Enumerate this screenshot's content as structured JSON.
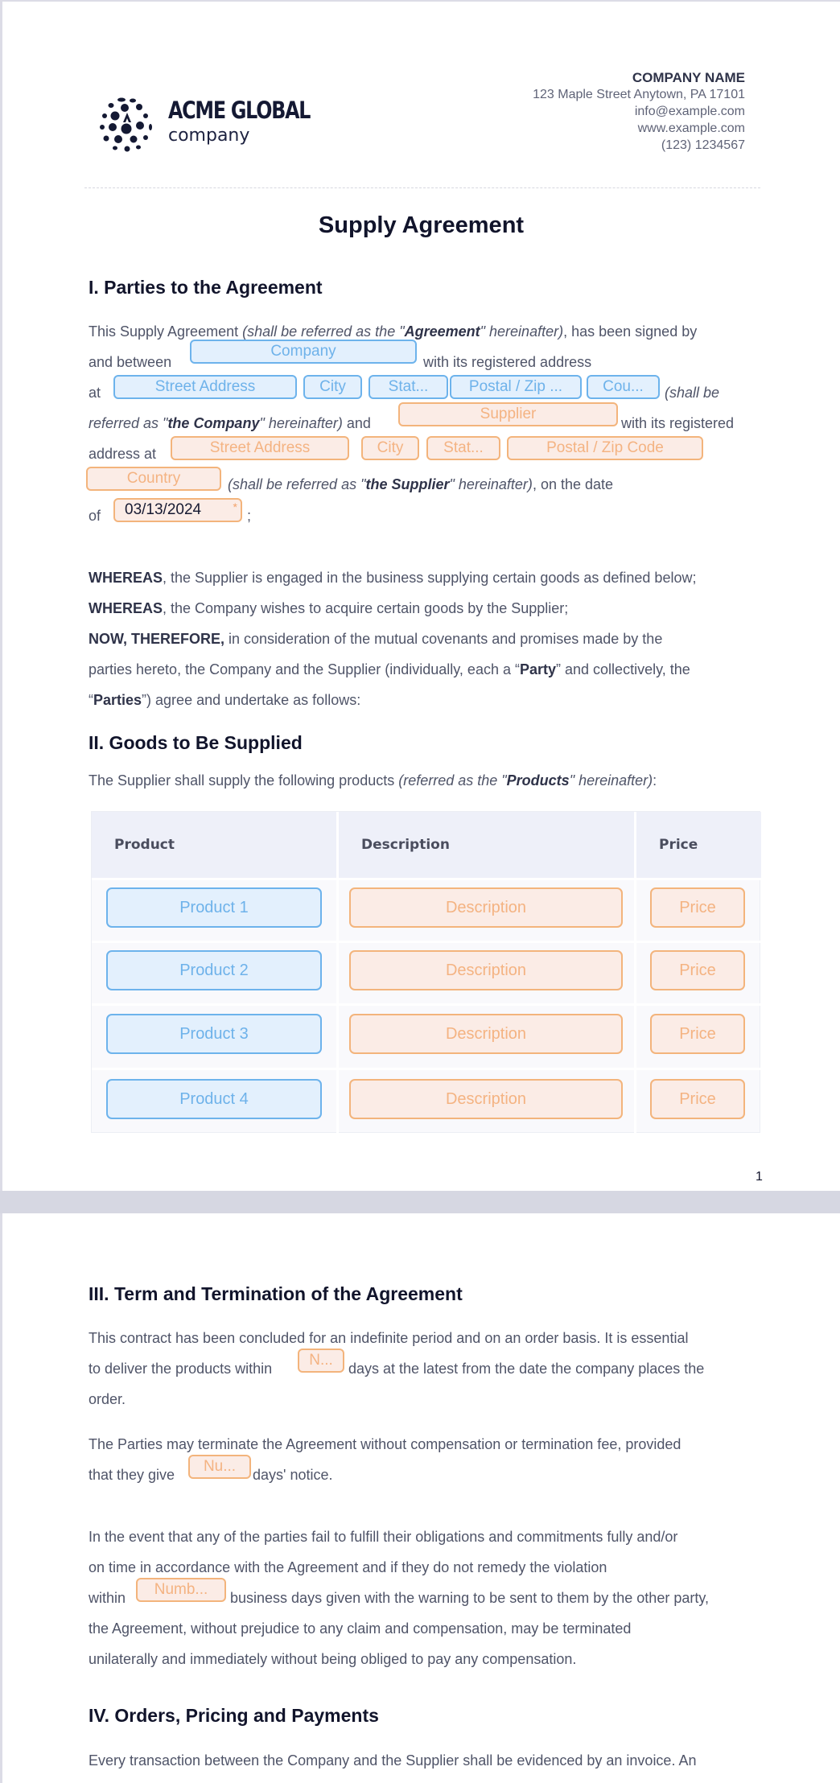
{
  "header": {
    "logo": {
      "title": "ACME GLOBAL",
      "subtitle": "company",
      "icon": "globe-dots-icon"
    },
    "company_block": {
      "name": "COMPANY NAME",
      "address": "123 Maple Street Anytown, PA 17101",
      "email": "info@example.com",
      "website": "www.example.com",
      "phone": "(123) 1234567"
    }
  },
  "document": {
    "title": "Supply Agreement",
    "colors": {
      "company_field": "#6db3ec",
      "supplier_field": "#f3b47c",
      "heading": "#11142b",
      "body_text": "#4f5468"
    }
  },
  "section1": {
    "heading": "I. Parties to the Agreement",
    "line1": {
      "a": "This Supply Agreement ",
      "b": "(shall be referred as the \"",
      "c": "Agreement",
      "d": "\" hereinafter)",
      "e": ", has been signed by"
    },
    "line2": {
      "a": "and between",
      "b": "with its registered address"
    },
    "line3": {
      "a": "at",
      "b": "(shall be"
    },
    "line4": {
      "a": "referred as \"",
      "b": "the Company",
      "c": "\" hereinafter)",
      "d": " and",
      "e": "with its registered"
    },
    "line5": {
      "a": "address at"
    },
    "line6": {
      "a": "(shall be referred as \"",
      "b": "the Supplier",
      "c": "\" hereinafter)",
      "d": ", on the date"
    },
    "line7": {
      "a": "of",
      "b": ";"
    },
    "company_fields": {
      "name": "Company",
      "street": "Street Address",
      "city": "City",
      "state": "Stat...",
      "postal": "Postal / Zip ...",
      "country": "Cou..."
    },
    "supplier_fields": {
      "name": "Supplier",
      "street": "Street Address",
      "city": "City",
      "state": "Stat...",
      "postal": "Postal / Zip Code",
      "country": "Country"
    },
    "date_field": {
      "value": "03/13/2024",
      "required_mark": "*"
    }
  },
  "recitals": {
    "r1": {
      "bold": "WHEREAS",
      "text": ", the Supplier is engaged in the business supplying certain goods as defined below;"
    },
    "r2": {
      "bold": "WHEREAS",
      "text": ", the Company wishes to acquire certain goods by the Supplier;"
    },
    "r3": {
      "bold": "NOW, THEREFORE,",
      "text": " in consideration of the mutual covenants and promises made by the"
    },
    "r4": {
      "a": "parties hereto, the Company and the Supplier (individually, each a “",
      "b": "Party",
      "c": "” and collectively, the"
    },
    "r5": {
      "a": "“",
      "b": "Parties",
      "c": "”) agree and undertake as follows:"
    }
  },
  "section2": {
    "heading": "II. Goods to Be Supplied",
    "intro": {
      "a": "The Supplier shall supply the following products ",
      "b": "(referred as the \"",
      "c": "Products",
      "d": "\" hereinafter)",
      "e": ":"
    },
    "table": {
      "headers": [
        "Product",
        "Description",
        "Price"
      ],
      "rows": [
        {
          "product": "Product 1",
          "description": "Description",
          "price": "Price"
        },
        {
          "product": "Product 2",
          "description": "Description",
          "price": "Price"
        },
        {
          "product": "Product 3",
          "description": "Description",
          "price": "Price"
        },
        {
          "product": "Product 4",
          "description": "Description",
          "price": "Price"
        }
      ]
    }
  },
  "page1_number": "1",
  "section3": {
    "heading": "III. Term and Termination of the Agreement",
    "p1": {
      "l1": "This contract has been concluded for an indefinite period and on an order basis. It is essential",
      "l2a": "to deliver the products within",
      "field": "N...",
      "l2b": "days at the latest from the date the company places the",
      "l3": "order."
    },
    "p2": {
      "l1": "The Parties may terminate the Agreement without compensation or termination fee, provided",
      "l2a": "that they give",
      "field": "Nu...",
      "l2b": "days' notice."
    },
    "p3": {
      "l1": "In the event that any of the parties fail to fulfill their obligations and commitments fully and/or",
      "l2": "on time in accordance with the Agreement and if they do not remedy the violation",
      "l3a": "within",
      "field": "Numb...",
      "l3b": "business days given with the warning to be sent to them by the other party,",
      "l4": "the Agreement, without prejudice to any claim and compensation, may be terminated",
      "l5": "unilaterally and immediately without being obliged to pay any compensation."
    }
  },
  "section4": {
    "heading": "IV. Orders, Pricing and Payments",
    "p1": "Every transaction between the Company and the Supplier shall be evidenced by an invoice. An"
  }
}
